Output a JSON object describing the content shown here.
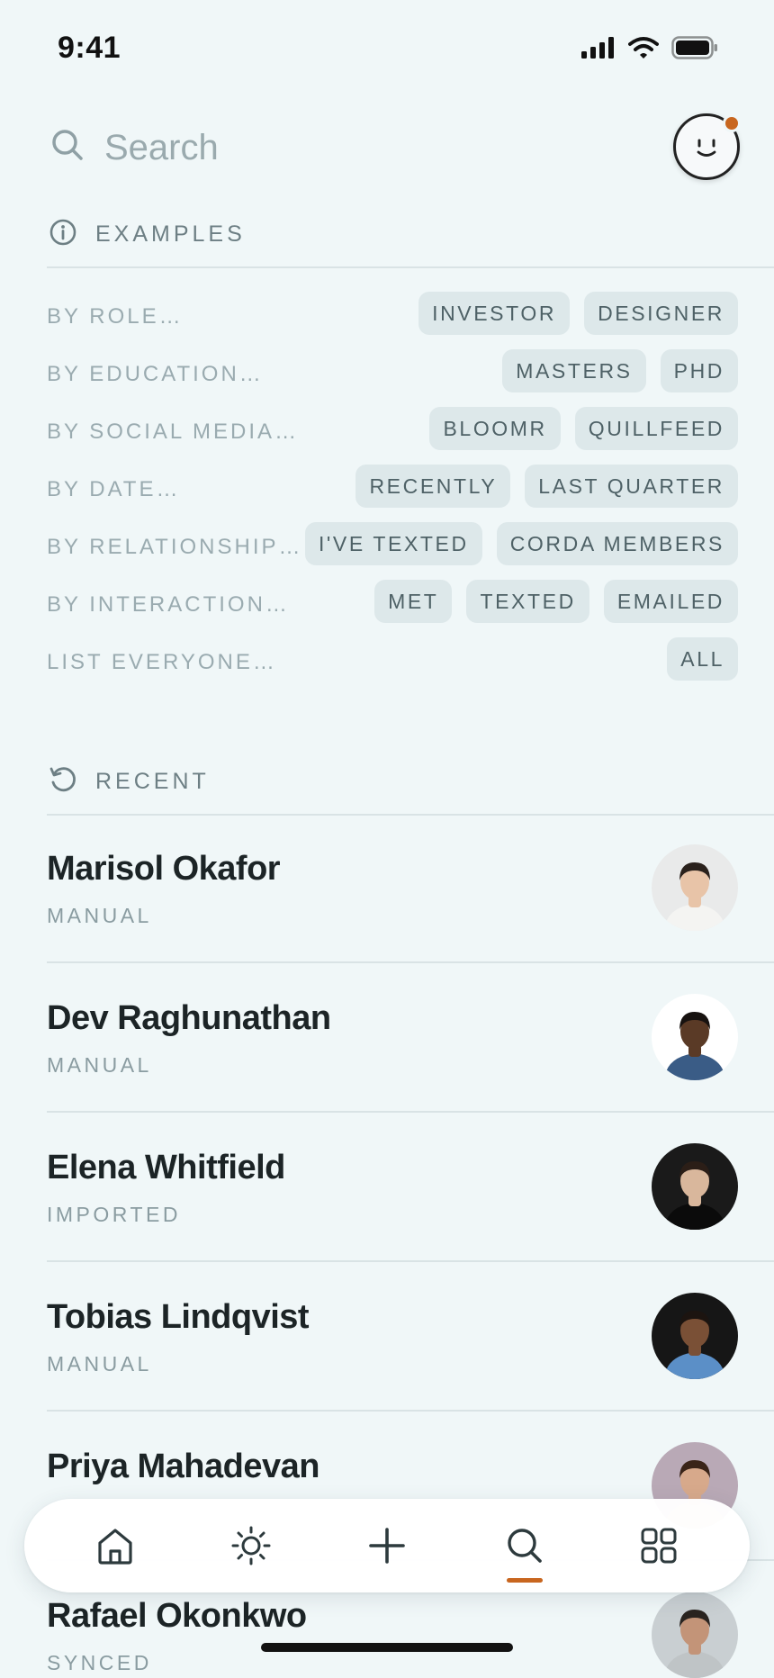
{
  "status_bar": {
    "time": "9:41"
  },
  "search": {
    "placeholder": "Search"
  },
  "examples": {
    "title": "EXAMPLES",
    "rows": [
      {
        "label": "BY ROLE…",
        "chips": [
          "INVESTOR",
          "DESIGNER"
        ]
      },
      {
        "label": "BY EDUCATION…",
        "chips": [
          "MASTERS",
          "PHD"
        ]
      },
      {
        "label": "BY SOCIAL MEDIA…",
        "chips": [
          "BLOOMR",
          "QUILLFEED"
        ]
      },
      {
        "label": "BY DATE…",
        "chips": [
          "RECENTLY",
          "LAST QUARTER"
        ]
      },
      {
        "label": "BY RELATIONSHIP…",
        "chips": [
          "I'VE TEXTED",
          "CORDA MEMBERS"
        ]
      },
      {
        "label": "BY INTERACTION…",
        "chips": [
          "MET",
          "TEXTED",
          "EMAILED"
        ]
      },
      {
        "label": "LIST EVERYONE…",
        "chips": [
          "ALL"
        ]
      }
    ]
  },
  "recent": {
    "title": "RECENT",
    "items": [
      {
        "name": "Marisol Okafor",
        "source": "MANUAL",
        "avatar_bg": "#e9eaea",
        "skin": "#e8c4a8",
        "hair": "#2a211c",
        "shirt": "#f4f4f2"
      },
      {
        "name": "Dev Raghunathan",
        "source": "MANUAL",
        "avatar_bg": "#ffffff",
        "skin": "#5a3a26",
        "hair": "#171210",
        "shirt": "#3a5c86"
      },
      {
        "name": "Elena Whitfield",
        "source": "IMPORTED",
        "avatar_bg": "#1a1a1a",
        "skin": "#d9b79c",
        "hair": "#2b1e17",
        "shirt": "#0b0b0b"
      },
      {
        "name": "Tobias Lindqvist",
        "source": "MANUAL",
        "avatar_bg": "#161616",
        "skin": "#7a5036",
        "hair": "#1c1410",
        "shirt": "#5b8fc7"
      },
      {
        "name": "Priya Mahadevan",
        "source": "",
        "avatar_bg": "#b9a9b6",
        "skin": "#d7a98b",
        "hair": "#3a2418",
        "shirt": "#d1c4a4"
      },
      {
        "name": "Rafael Okonkwo",
        "source": "SYNCED",
        "avatar_bg": "#c9cfd2",
        "skin": "#c39478",
        "hair": "#2a2420",
        "shirt": "#bfc4c6"
      }
    ]
  },
  "tabs": [
    {
      "id": "home",
      "icon": "home-icon"
    },
    {
      "id": "discover",
      "icon": "sun-icon"
    },
    {
      "id": "add",
      "icon": "plus-icon"
    },
    {
      "id": "search",
      "icon": "search-icon",
      "active": true
    },
    {
      "id": "apps",
      "icon": "grid-icon"
    }
  ],
  "colors": {
    "accent": "#c8661f",
    "background": "#f0f7f8",
    "chip_bg": "#dde8ea",
    "chip_text": "#4e6166"
  }
}
